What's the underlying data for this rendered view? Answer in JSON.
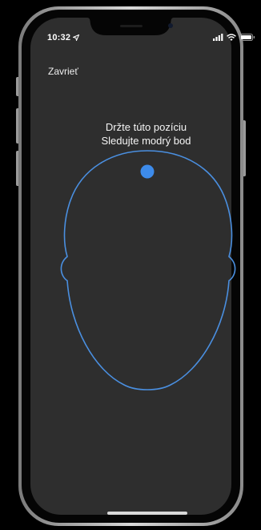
{
  "status_bar": {
    "time": "10:32",
    "location_icon": "location-arrow-icon",
    "signal_icon": "cellular-signal-icon",
    "wifi_icon": "wifi-icon",
    "battery_icon": "battery-icon"
  },
  "nav": {
    "close_label": "Zavrieť"
  },
  "instructions": {
    "line1": "Držte túto pozíciu",
    "line2": "Sledujte modrý bod"
  },
  "face_guide": {
    "outline_color": "#4a8fe0",
    "dot_color": "#3d8bea"
  },
  "colors": {
    "screen_background": "#2e2e2e",
    "bezel": "#050505",
    "frame": "#b8b8b8"
  }
}
